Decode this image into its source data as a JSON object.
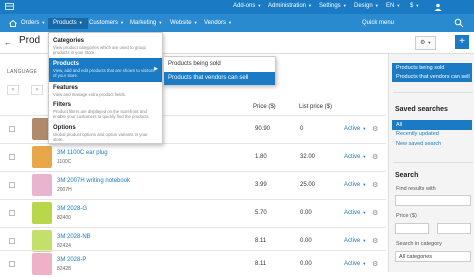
{
  "topbar": {
    "cart_label": "",
    "addons": "Add-ons",
    "administration": "Administration",
    "settings": "Settings",
    "design": "Design",
    "lang": "EN",
    "currency": "$"
  },
  "nav": {
    "orders": "Orders",
    "products": "Products",
    "customers": "Customers",
    "marketing": "Marketing",
    "website": "Website",
    "vendors": "Vendors",
    "quick_menu": "Quick menu"
  },
  "header": {
    "back": "←",
    "title": "Prod",
    "add": "+"
  },
  "table": {
    "lang_label": "LANGUAGE",
    "pager": [
      "«",
      "»"
    ],
    "col_price": "Price ($)",
    "col_list_price": "List price ($)",
    "rows": [
      {
        "name": "",
        "code": "",
        "price": "90.90",
        "list_price": "0",
        "status": "Active",
        "color": "#b08a6a"
      },
      {
        "name": "3M 1100C ear plug",
        "code": "1100C",
        "price": "1.80",
        "list_price": "32.00",
        "status": "Active",
        "color": "#e8a84a"
      },
      {
        "name": "3M 2007H writing notebook",
        "code": "2007H",
        "price": "3.99",
        "list_price": "25.00",
        "status": "Active",
        "color": "#e8b4d0"
      },
      {
        "name": "3M 2028-G",
        "code": "82400",
        "price": "5.70",
        "list_price": "0.00",
        "status": "Active",
        "color": "#b8d84a"
      },
      {
        "name": "3M 2028-NB",
        "code": "82424",
        "price": "8.11",
        "list_price": "0.00",
        "status": "Active",
        "color": "#c4e06a"
      },
      {
        "name": "3M 2028-P",
        "code": "82428",
        "price": "8.11",
        "list_price": "0.00",
        "status": "Active",
        "color": "#f0b0c8"
      }
    ]
  },
  "dropdown": {
    "items": [
      {
        "title": "Categories",
        "desc": "View product categories which are used to group products in your store."
      },
      {
        "title": "Products",
        "desc": "View, add and edit products that are shown to visitors of your store."
      },
      {
        "title": "Features",
        "desc": "View and manage extra product fields."
      },
      {
        "title": "Filters",
        "desc": "Product filters are displayed on the storefront and enable your customers to quickly find the products."
      },
      {
        "title": "Options",
        "desc": "Global product options and option variants in your store."
      }
    ],
    "arrow": "▶",
    "submenu": [
      "Products being sold",
      "Products that vendors can sell"
    ]
  },
  "sidebar": {
    "views": [
      "Products being sold",
      "Products that vendors can sell"
    ],
    "saved_title": "Saved searches",
    "saved": [
      "All",
      "Recently updated",
      "New saved search"
    ],
    "search_title": "Search",
    "find_label": "Find results with",
    "price_label": "Price ($)",
    "category_label": "Search in category",
    "category_value": "All categories"
  }
}
